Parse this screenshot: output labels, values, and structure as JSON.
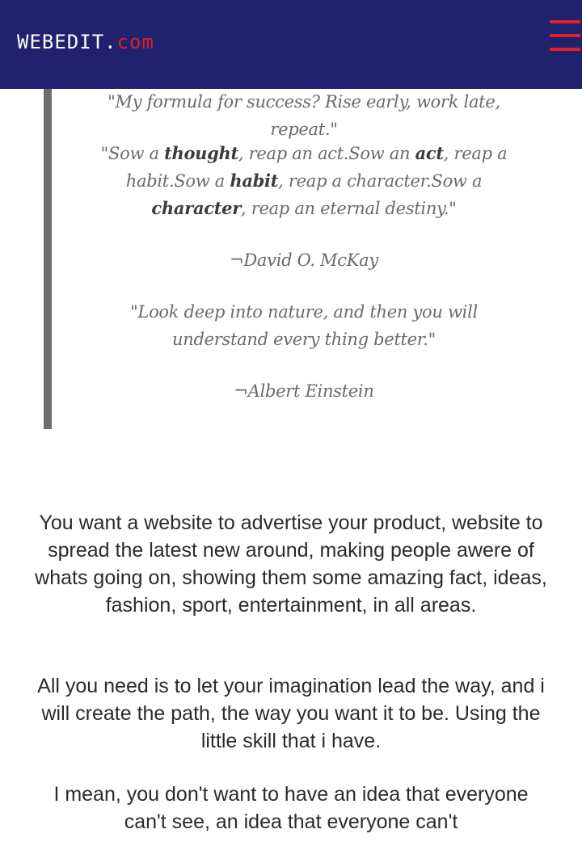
{
  "header": {
    "brand_main": "WEBEDIT.",
    "brand_tld": "com",
    "menu_icon": "hamburger-menu-icon",
    "colors": {
      "background": "#20226e",
      "accent": "#d9202a"
    }
  },
  "quotes": {
    "q1": "\"My formula for success? Rise early, work late, repeat.\"",
    "q2": {
      "p1": "\"Sow a ",
      "w1": "thought",
      "p2": ", reap an act.Sow an ",
      "w2": "act",
      "p3": ", reap a habit.Sow a ",
      "w3": "habit",
      "p4": ", reap a character.Sow a ",
      "w4": "character",
      "p5": ", reap an eternal destiny.\""
    },
    "a2": "¬David O. McKay",
    "q3": "\"Look deep into nature, and then you will understand every thing better.\"",
    "a3": "¬Albert Einstein"
  },
  "content": {
    "p1": "You want a website to advertise your product, website to spread the latest new around, making people awere of whats going on, showing them some amazing fact, ideas, fashion, sport, entertainment, in all areas.",
    "p2": "All you need is to let your imagination lead the way, and i will create the path, the way you want it to be. Using the little skill that i have.",
    "p3": "I mean, you don't want to have an idea that everyone can't see, an idea that everyone can't"
  }
}
